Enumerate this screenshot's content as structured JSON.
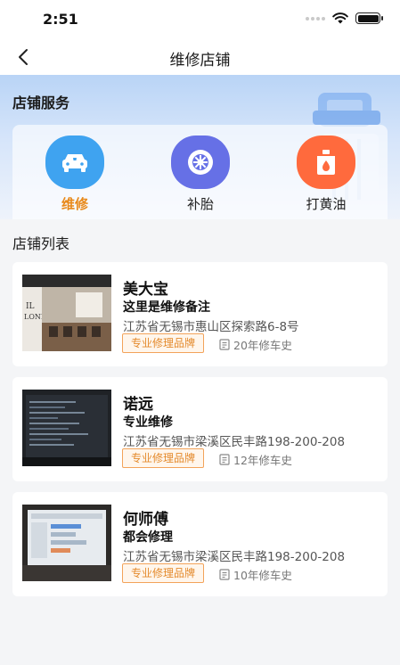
{
  "status_bar": {
    "time": "2:51",
    "icons": [
      "signal-icon",
      "wifi-icon",
      "battery-icon"
    ]
  },
  "nav": {
    "back_icon": "chevron-left-icon",
    "title": "维修店铺"
  },
  "service_section": {
    "title": "店铺服务",
    "items": [
      {
        "label": "维修",
        "icon": "car-repair-icon",
        "color": "#3fa3f0",
        "active": true
      },
      {
        "label": "补胎",
        "icon": "tire-icon",
        "color": "#6670e6",
        "active": false
      },
      {
        "label": "打黄油",
        "icon": "oil-can-icon",
        "color": "#ff6a3d",
        "active": false
      }
    ]
  },
  "list_section": {
    "title": "店铺列表",
    "shops": [
      {
        "name": "美大宝",
        "note": "这里是维修备注",
        "address": "江苏省无锡市惠山区探索路6-8号",
        "tag": "专业修理品牌",
        "history": "20年修车史"
      },
      {
        "name": "诺远",
        "note": "专业维修",
        "address": "江苏省无锡市梁溪区民丰路198-200-208",
        "tag": "专业修理品牌",
        "history": "12年修车史"
      },
      {
        "name": "何师傅",
        "note": "都会修理",
        "address": "江苏省无锡市梁溪区民丰路198-200-208",
        "tag": "专业修理品牌",
        "history": "10年修车史"
      }
    ]
  },
  "colors": {
    "accent": "#e8891a",
    "tag_border": "#f3a35a",
    "header_gradient_top": "#b9d4f6"
  }
}
